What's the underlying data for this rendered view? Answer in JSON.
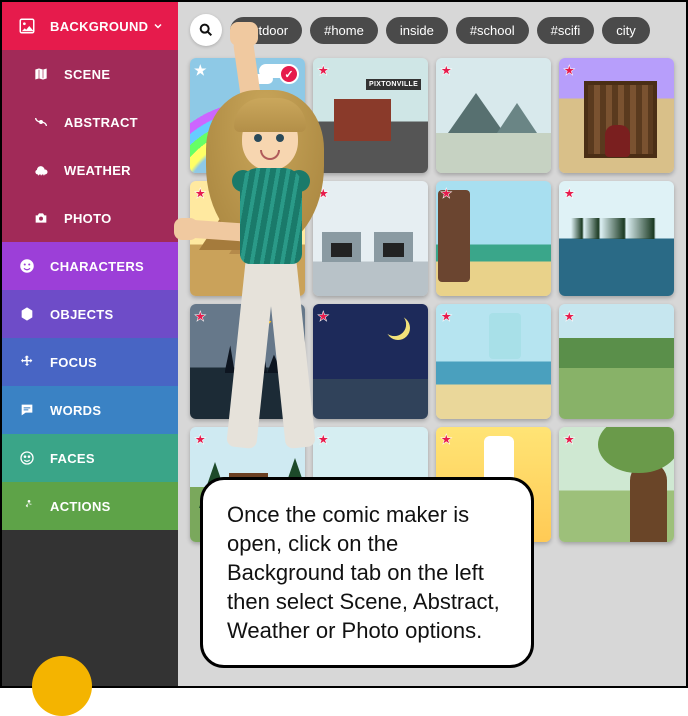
{
  "sidebar": {
    "background": {
      "label": "BACKGROUND"
    },
    "scene": {
      "label": "SCENE"
    },
    "abstract": {
      "label": "ABSTRACT"
    },
    "weather": {
      "label": "WEATHER"
    },
    "photo": {
      "label": "PHOTO"
    },
    "characters": {
      "label": "CHARACTERS"
    },
    "objects": {
      "label": "OBJECTS"
    },
    "focus": {
      "label": "FOCUS"
    },
    "words": {
      "label": "WORDS"
    },
    "faces": {
      "label": "FACES"
    },
    "actions": {
      "label": "ACTIONS"
    }
  },
  "tags": {
    "t0": "outdoor",
    "t1": "#home",
    "t2": "inside",
    "t3": "#school",
    "t4": "#scifi",
    "t5": "city"
  },
  "thumbs": {
    "building_sign": "PIXTONVILLE"
  },
  "speech": {
    "text": "Once the comic maker is open, click on the Background tab on the left then select Scene, Abstract, Weather or Photo options."
  },
  "colors": {
    "accent": "#e61b4c"
  }
}
